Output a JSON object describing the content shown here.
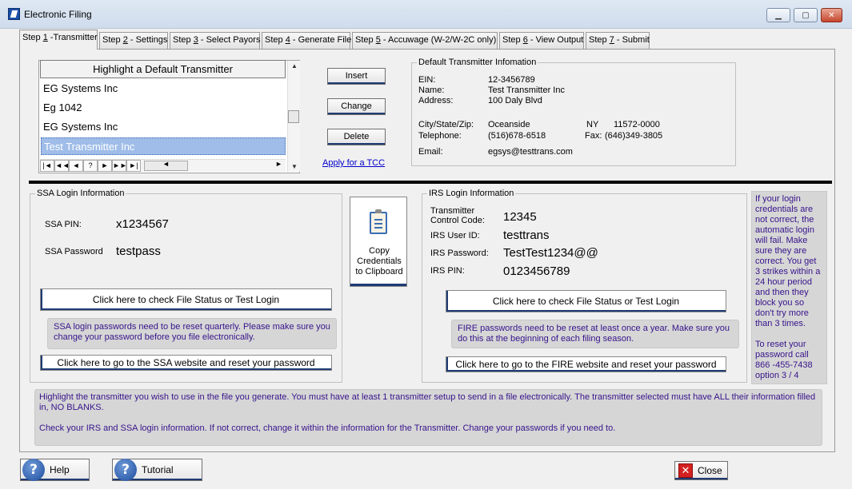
{
  "window": {
    "title": "Electronic Filing"
  },
  "tabs": [
    {
      "prefix": "Step ",
      "key": "1",
      "rest": " -Transmitter"
    },
    {
      "prefix": "Step ",
      "key": "2",
      "rest": " - Settings"
    },
    {
      "prefix": "Step ",
      "key": "3",
      "rest": " - Select Payors"
    },
    {
      "prefix": "Step ",
      "key": "4",
      "rest": " - Generate File"
    },
    {
      "prefix": "Step ",
      "key": "5",
      "rest": " - Accuwage (W-2/W-2C only)"
    },
    {
      "prefix": "Step ",
      "key": "6",
      "rest": " - View Output"
    },
    {
      "prefix": "Step ",
      "key": "7",
      "rest": " - Submit"
    }
  ],
  "transmitters": {
    "header": "Highlight a Default Transmitter",
    "items": [
      "EG Systems Inc",
      "Eg 1042",
      "EG Systems Inc",
      "Test Transmitter Inc"
    ],
    "selected_index": 3
  },
  "nav_buttons": [
    "|◄",
    "◄◄",
    "◄",
    "?",
    "►",
    "►►",
    "►|"
  ],
  "actions": {
    "insert": "Insert",
    "change": "Change",
    "delete": "Delete",
    "apply_tcc": "Apply for a TCC"
  },
  "default_transmitter": {
    "title": "Default Transmitter Infomation",
    "ein_label": "EIN:",
    "ein": "12-3456789",
    "name_label": "Name:",
    "name": "Test Transmitter Inc",
    "address_label": "Address:",
    "address": "100 Daly Blvd",
    "city_label": "City/State/Zip:",
    "city": "Oceanside",
    "state": "NY",
    "zip": "11572-0000",
    "telephone_label": "Telephone:",
    "telephone": "(516)678-6518",
    "fax_label": "Fax:",
    "fax": "(646)349-3805",
    "email_label": "Email:",
    "email": "egsys@testtrans.com"
  },
  "ssa": {
    "title": "SSA Login Information",
    "pin_label": "SSA PIN:",
    "pin": "x1234567",
    "password_label": "SSA Password",
    "password": "testpass",
    "check_button": "Click here to check File Status or Test Login",
    "note": "SSA login passwords need to be reset quarterly.   Please make sure you change your password before you file electronically.",
    "website_button": "Click here to go to the SSA website and reset your password"
  },
  "copy_button": {
    "line1": "Copy",
    "line2": "Credentials",
    "line3": "to Clipboard"
  },
  "irs": {
    "title": "IRS Login Information",
    "tcc_label_1": "Transmitter",
    "tcc_label_2": "Control Code:",
    "tcc": "12345",
    "user_label": "IRS User ID:",
    "user": "testtrans",
    "password_label": "IRS Password:",
    "password": "TestTest1234@@",
    "pin_label": "IRS PIN:",
    "pin": "0123456789",
    "check_button": "Click here to check File Status or Test Login",
    "note": "FIRE passwords need to be reset at least once a year.   Make sure you do this at the beginning of each filing season.",
    "website_button": "Click here to go to the FIRE website and reset your password"
  },
  "side_note": {
    "p1": "If your login credentials are not correct, the automatic login will fail.  Make sure they are correct.  You get 3 strikes within a 24 hour period and then they block you so don't try more than 3 times.",
    "p2": "To reset your password call 866 -455-7438 option 3 / 4"
  },
  "bottom_note": {
    "p1": "Highlight the transmitter you wish to use in the file you generate.  You must have at least 1 transmitter setup to send in a file electronically.  The transmitter selected must have ALL their information filled in, NO BLANKS.",
    "p2": "Check your IRS and SSA login information.   If not correct, change it within the information for the Transmitter.   Change your passwords if you need to."
  },
  "footer": {
    "help": "Help",
    "tutorial": "Tutorial",
    "close": "Close"
  },
  "colors": {
    "note_text": "#36138b",
    "selection": "#9fbde8",
    "button_accent": "#1f3b73"
  }
}
